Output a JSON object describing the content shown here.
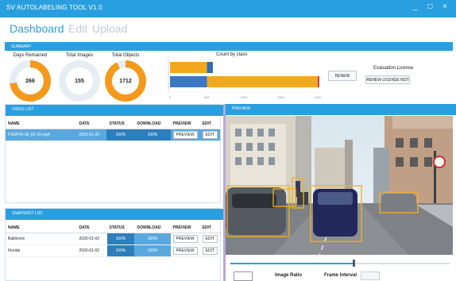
{
  "window": {
    "title": "SV AUTOLABELING TOOL V1.0",
    "controls": [
      "_",
      "□",
      "×"
    ]
  },
  "menu": {
    "dashboard": "Dashboard",
    "edit": "Edit",
    "upload": "Upload"
  },
  "summary": {
    "header": "SUMMARY",
    "days_caption": "Days Remained",
    "images_caption": "Total Images",
    "objects_caption": "Total Objects",
    "days_value": "266",
    "images_value": "155",
    "objects_value": "1712",
    "days_fraction": 0.73,
    "objects_fraction": 0.93,
    "count_title": "Count by class",
    "renew_label": "RENEW",
    "license_title": "Evaluation License",
    "license_button": "RENEW LICENSE NOT",
    "count_bars": [
      {
        "segments": [
          {
            "value": 500,
            "color": "#f2a81d"
          },
          {
            "value": 80,
            "color": "#2f6fb5"
          }
        ]
      },
      {
        "segments": [
          {
            "value": 500,
            "color": "#3a78c2"
          },
          {
            "value": 1500,
            "color": "#f2a81d"
          },
          {
            "value": 20,
            "color": "#d2304c"
          }
        ]
      }
    ],
    "count_axis": [
      "0",
      "500",
      "1000",
      "1500",
      "2000"
    ]
  },
  "video_list": {
    "header": "VIDEO LIST",
    "columns": [
      "NAME",
      "DATE",
      "STATUS",
      "DOWNLOAD",
      "PREVIEW",
      "EDIT"
    ],
    "rows": [
      {
        "name": "PSSP04-18_05-10.mp4",
        "date": "2020-01-20",
        "status": "100%",
        "download": "100%",
        "preview": "PREVIEW",
        "edit": "EDIT"
      }
    ]
  },
  "snapshot_list": {
    "header": "SNAPSHOT LIST",
    "columns": [
      "NAME",
      "DATE",
      "STATUS",
      "DOWNLOAD",
      "PREVIEW",
      "EDIT"
    ],
    "rows": [
      {
        "name": "Baltimore",
        "date": "2020-01-02",
        "status": "100%",
        "download": "100%",
        "preview": "PREVIEW",
        "edit": "EDIT"
      },
      {
        "name": "Florida",
        "date": "2020-01-02",
        "status": "100%",
        "download": "100%",
        "preview": "PREVIEW",
        "edit": "EDIT"
      }
    ]
  },
  "preview": {
    "header": "PREVIEW",
    "slider_position": 0.56,
    "image_ratio_label": "Image Ratio",
    "frame_interval_label": "Frame Interval"
  },
  "colors": {
    "accent": "#2a9fe0",
    "donut_orange": "#f39a1d",
    "donut_track": "#e6edf3"
  }
}
